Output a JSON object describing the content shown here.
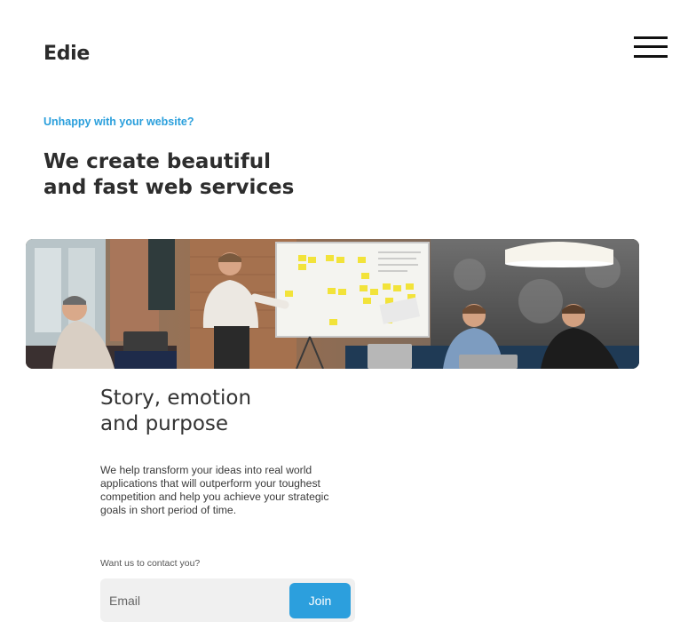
{
  "header": {
    "logo": "Edie",
    "menu_icon": "hamburger-menu-icon"
  },
  "hero": {
    "eyebrow": "Unhappy with your website?",
    "title_line_1": "We create beautiful",
    "title_line_2": "and fast web services",
    "image": "team-meeting-photo",
    "accent_color": "#2a9fdc"
  },
  "story": {
    "title_line_1": "Story, emotion",
    "title_line_2": "and purpose",
    "body": "We help transform your ideas into real world applications that will outperform your toughest competition and help you achieve your strategic goals in short period of time."
  },
  "contact": {
    "label": "Want us to contact you?",
    "email_placeholder": "Email",
    "email_value": "",
    "join_label": "Join",
    "button_color": "#2c9fdd"
  }
}
